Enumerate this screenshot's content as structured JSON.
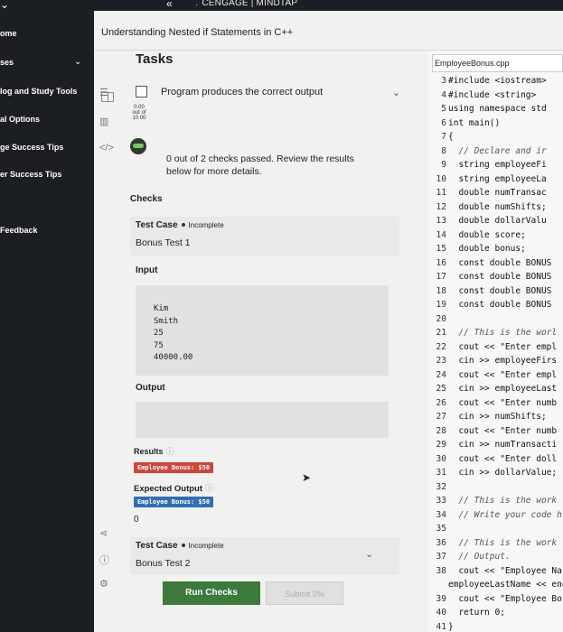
{
  "brand": {
    "name": "CENGAGE | MINDTAP"
  },
  "left_nav": {
    "items": [
      {
        "label": "ome"
      },
      {
        "label": "ses"
      },
      {
        "label": "log and Study Tools"
      },
      {
        "label": "al Options"
      },
      {
        "label": "ge Success Tips"
      },
      {
        "label": "er Success Tips"
      },
      {
        "label": "Feedback"
      }
    ]
  },
  "course": {
    "title": "Understanding Nested if Statements in C++"
  },
  "tasks": {
    "heading": "Tasks",
    "task_label": "Program produces the correct output",
    "score_top": "0.00",
    "score_mid": "out of",
    "score_bottom": "10.00",
    "checks_message": "0 out of 2 checks passed. Review the results below for more details.",
    "checks_label": "Checks"
  },
  "test_case_1": {
    "title": "Test Case",
    "status": "Incomplete",
    "name": "Bonus Test 1",
    "input_label": "Input",
    "input_lines": [
      "Kim",
      "Smith",
      "25",
      "75",
      "40000.00"
    ],
    "output_label": "Output",
    "results_label": "Results",
    "result_badge": "Employee Bonus: $50",
    "expected_label": "Expected Output",
    "expected_badge": "Employee Bonus: $50",
    "zero": "0"
  },
  "test_case_2": {
    "title": "Test Case",
    "status": "Incomplete",
    "name": "Bonus Test 2"
  },
  "buttons": {
    "run": "Run Checks",
    "submit": "Submit 0%"
  },
  "editor": {
    "filename": "EmployeeBonus.cpp",
    "line_numbers": [
      "3",
      "4",
      "5",
      "6",
      "7",
      "8",
      "9",
      "10",
      "11",
      "12",
      "13",
      "14",
      "15",
      "16",
      "17",
      "18",
      "19",
      "20",
      "21",
      "22",
      "23",
      "24",
      "25",
      "26",
      "27",
      "28",
      "29",
      "30",
      "31",
      "32",
      "33",
      "34",
      "35",
      "36",
      "37",
      "38",
      "",
      "39",
      "40",
      "41"
    ],
    "lines": [
      "#include <iostream>",
      "#include <string>",
      "using namespace std",
      "int main()",
      "{",
      "  // Declare and ir",
      "  string employeeFi",
      "  string employeeLa",
      "  double numTransac",
      "  double numShifts;",
      "  double dollarValu",
      "  double score;",
      "  double bonus;",
      "  const double BONUS",
      "  const double BONUS",
      "  const double BONUS",
      "  const double BONUS",
      "",
      "  // This is the worl",
      "  cout << \"Enter empl",
      "  cin >> employeeFirs",
      "  cout << \"Enter empl",
      "  cin >> employeeLast",
      "  cout << \"Enter numb",
      "  cin >> numShifts;",
      "  cout << \"Enter numb",
      "  cin >> numTransacti",
      "  cout << \"Enter doll",
      "  cin >> dollarValue;",
      "",
      "  // This is the work",
      "  // Write your code h",
      "",
      "  // This is the work",
      "  // Output.",
      "  cout << \"Employee Nar",
      "employeeLastName << endl",
      "  cout << \"Employee Bor",
      "  return 0;",
      "}"
    ]
  },
  "colors": {
    "nav_bg": "#1b1e22",
    "run_button": "#3b7a3a",
    "result_badge": "#d0453a",
    "expected_badge": "#2f6fb4"
  }
}
